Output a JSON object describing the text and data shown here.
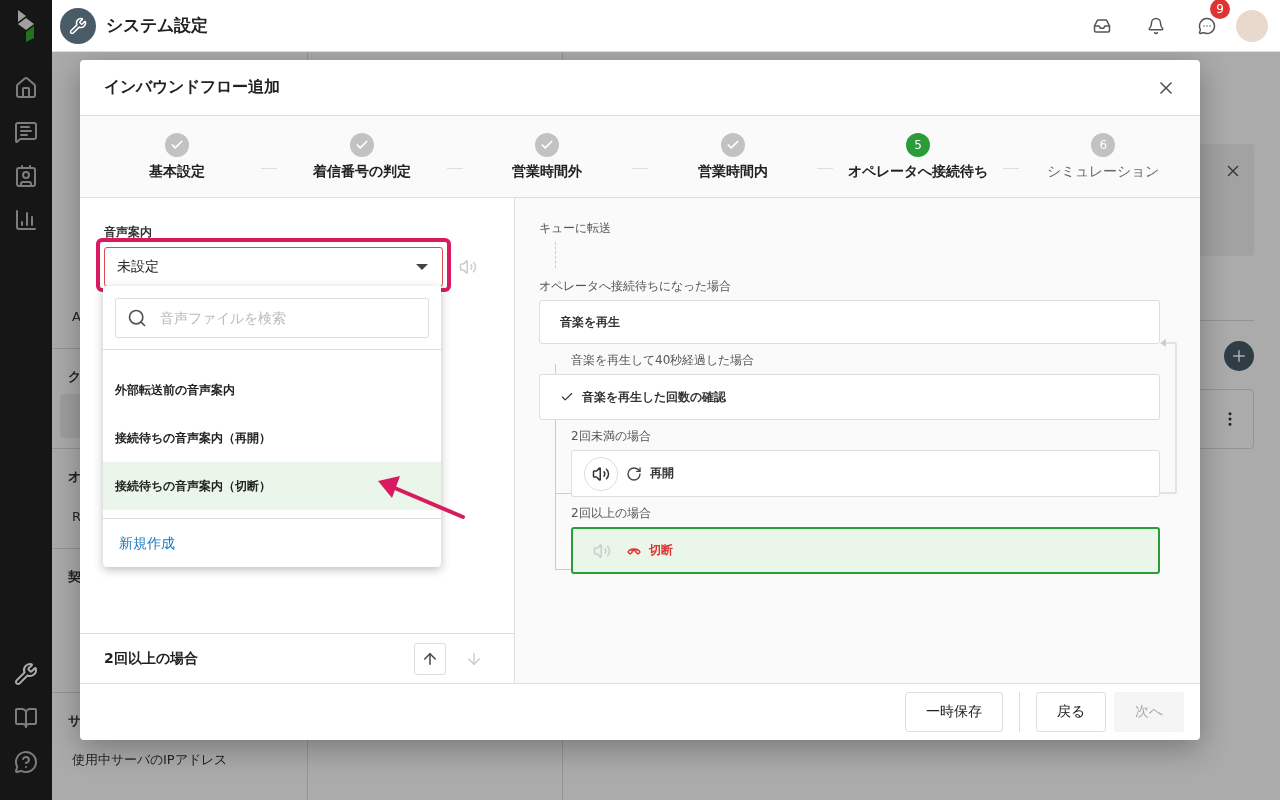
{
  "app": {
    "title": "システム設定",
    "notification_count": "9"
  },
  "settings_nav": [
    {
      "kind": "item",
      "selected": false
    },
    {
      "kind": "item",
      "selected": false
    },
    {
      "kind": "item",
      "selected": false
    },
    {
      "kind": "item",
      "selected": false
    },
    {
      "kind": "item",
      "selected": false
    },
    {
      "kind": "item",
      "selected": false
    },
    {
      "kind": "item",
      "label": "A",
      "selected": false
    },
    {
      "kind": "heading",
      "label": "ク"
    },
    {
      "kind": "item",
      "selected": true
    },
    {
      "kind": "heading",
      "label": "オ"
    },
    {
      "kind": "item",
      "label": "R",
      "selected": false
    },
    {
      "kind": "heading",
      "label": "契"
    },
    {
      "kind": "item",
      "selected": false
    },
    {
      "kind": "item",
      "selected": false
    },
    {
      "kind": "heading",
      "label": "サ"
    },
    {
      "kind": "item",
      "label": "使用中サーバのIPアドレス",
      "selected": false
    }
  ],
  "dialog": {
    "title": "インバウンドフロー追加",
    "steps": [
      {
        "label": "基本設定",
        "done": true,
        "current": false
      },
      {
        "label": "着信番号の判定",
        "done": true,
        "current": false
      },
      {
        "label": "営業時間外",
        "done": true,
        "current": false
      },
      {
        "label": "営業時間内",
        "done": true,
        "current": false
      },
      {
        "label": "オペレータへ接続待ち",
        "done": false,
        "current": true,
        "number": "5"
      },
      {
        "label": "シミュレーション",
        "done": false,
        "current": false,
        "number": "6"
      }
    ],
    "voice": {
      "label": "音声案内",
      "value": "未設定",
      "search_placeholder": "音声ファイルを検索",
      "options": [
        {
          "label": "外部転送前の音声案内",
          "selected": false
        },
        {
          "label": "接続待ちの音声案内（再開）",
          "selected": false
        },
        {
          "label": "接続待ちの音声案内（切断）",
          "selected": true
        }
      ],
      "create_link": "新規作成"
    },
    "section": {
      "title": "2回以上の場合",
      "up_disabled": false,
      "down_disabled": true
    },
    "flow": {
      "transfer": "キューに転送",
      "trigger": "オペレータへ接続待ちになった場合",
      "play": "音楽を再生",
      "after": "音楽を再生して40秒経過した場合",
      "check": "音楽を再生した回数の確認",
      "branches": [
        {
          "condition": "2回未満の場合",
          "action": "再開",
          "kind": "resume",
          "audio": true,
          "selected": false
        },
        {
          "condition": "2回以上の場合",
          "action": "切断",
          "kind": "hangup",
          "audio": false,
          "selected": true
        }
      ]
    },
    "buttons": [
      {
        "label": "一時保存",
        "disabled": false
      },
      {
        "label": "戻る",
        "disabled": false
      },
      {
        "label": "次へ",
        "disabled": true
      }
    ]
  }
}
